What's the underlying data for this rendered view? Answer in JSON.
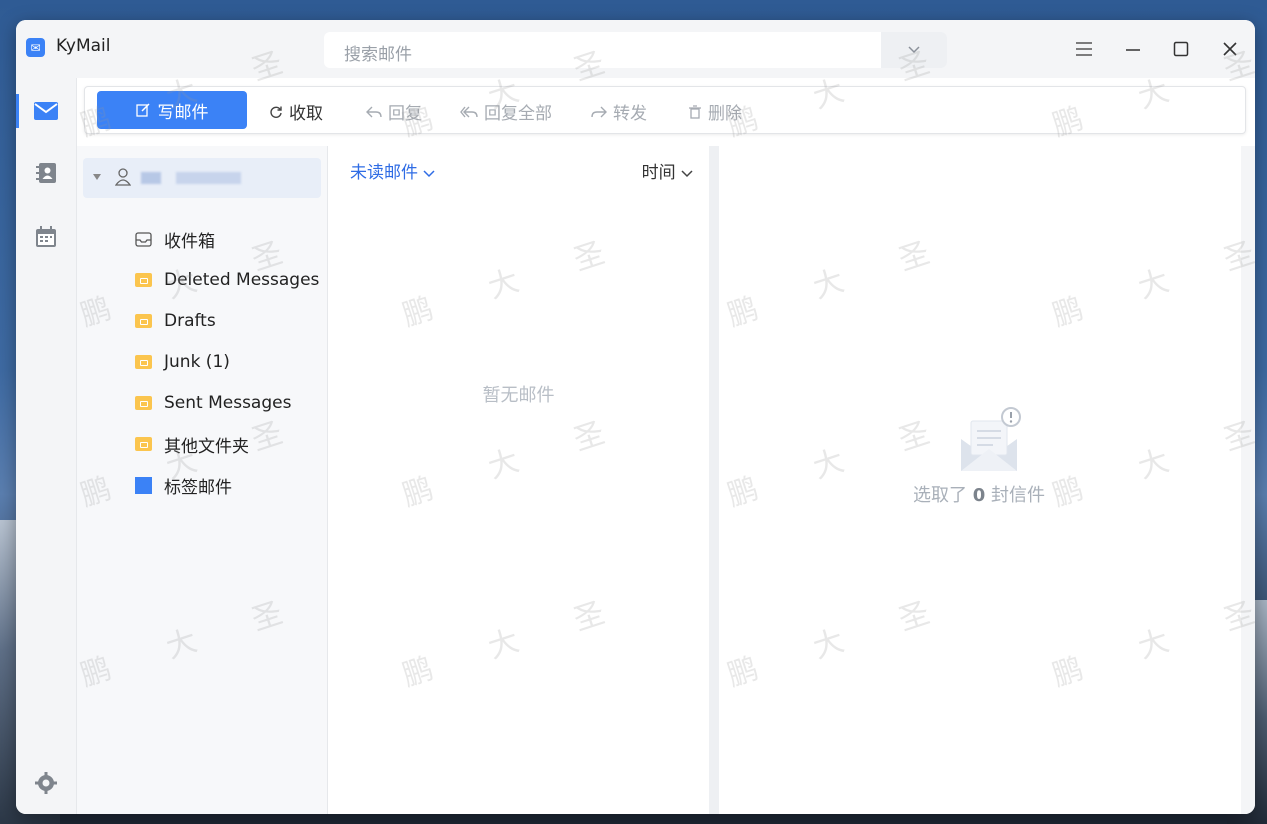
{
  "window": {
    "app_title": "KyMail",
    "search_placeholder": "搜索邮件"
  },
  "toolbar": {
    "compose": "写邮件",
    "receive": "收取",
    "reply": "回复",
    "reply_all": "回复全部",
    "forward": "转发",
    "delete": "删除"
  },
  "folders": [
    {
      "label": "收件箱",
      "icon": "inbox-icon"
    },
    {
      "label": "Deleted Messages",
      "icon": "folder-icon"
    },
    {
      "label": "Drafts",
      "icon": "folder-icon"
    },
    {
      "label": "Junk (1)",
      "icon": "folder-icon"
    },
    {
      "label": "Sent Messages",
      "icon": "folder-icon"
    },
    {
      "label": "其他文件夹",
      "icon": "folder-icon"
    },
    {
      "label": "标签邮件",
      "icon": "tag-square-icon"
    }
  ],
  "list": {
    "filter_label": "未读邮件",
    "sort_label": "时间",
    "empty_text": "暂无邮件"
  },
  "reading": {
    "selected_prefix": "选取了",
    "selected_count": "0",
    "selected_suffix": "封信件"
  },
  "watermark": {
    "text": "鹏大圣"
  },
  "colors": {
    "accent": "#3b82f6",
    "folder": "#fbc54e",
    "link": "#2f6ce5"
  }
}
